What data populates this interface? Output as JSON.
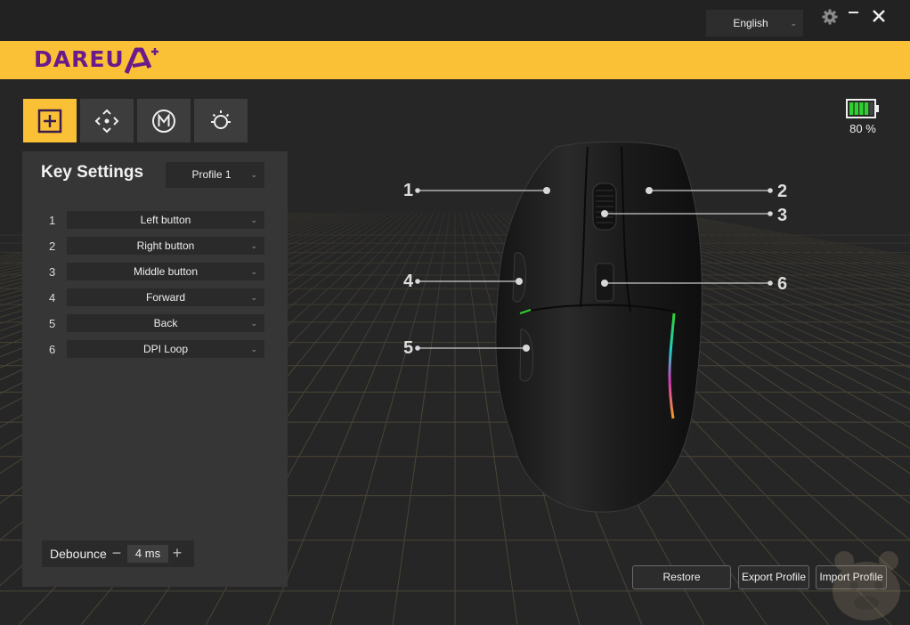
{
  "window": {
    "language": "English",
    "controls": [
      "settings-icon",
      "minimize-icon",
      "close-icon"
    ]
  },
  "brand": {
    "logo_text": "DAREU",
    "logo_mark": "A+"
  },
  "tabs": [
    {
      "icon": "key-settings-icon",
      "active": true
    },
    {
      "icon": "dpi-icon",
      "active": false
    },
    {
      "icon": "macro-icon",
      "active": false
    },
    {
      "icon": "lighting-icon",
      "active": false
    }
  ],
  "key_settings": {
    "title": "Key Settings",
    "profile": "Profile 1",
    "rows": [
      {
        "num": "1",
        "value": "Left button"
      },
      {
        "num": "2",
        "value": "Right button"
      },
      {
        "num": "3",
        "value": "Middle button"
      },
      {
        "num": "4",
        "value": "Forward"
      },
      {
        "num": "5",
        "value": "Back"
      },
      {
        "num": "6",
        "value": "DPI Loop"
      }
    ],
    "debounce": {
      "label": "Debounce",
      "value": "4 ms"
    }
  },
  "battery": {
    "percent": "80 %",
    "level": 0.8
  },
  "callouts": [
    "1",
    "2",
    "3",
    "4",
    "5",
    "6"
  ],
  "buttons": {
    "restore": "Restore",
    "export": "Export Profile",
    "import": "Import Profile"
  },
  "colors": {
    "accent": "#fac136",
    "brand": "#6a1a8a",
    "battery": "#2fd12f"
  }
}
